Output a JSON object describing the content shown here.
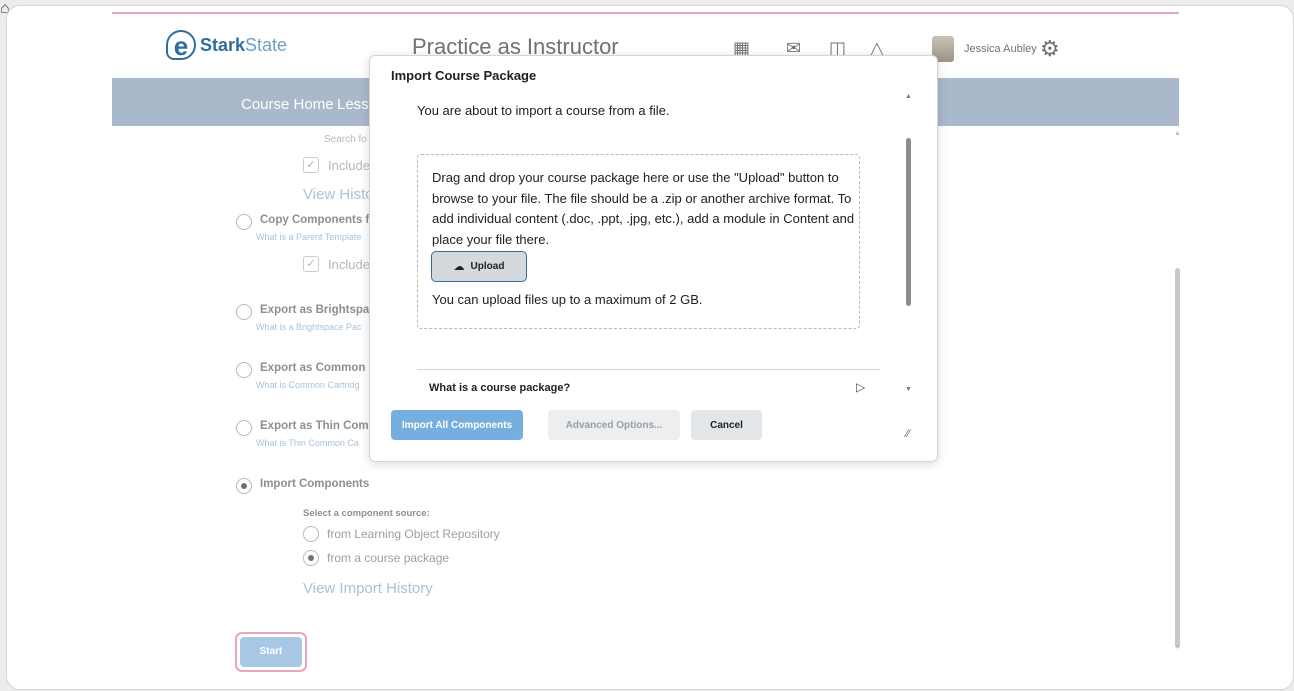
{
  "header": {
    "logo_bold": "Stark",
    "logo_light": "State",
    "org_unit_title": "Practice as Instructor",
    "user_name": "Jessica Aubley",
    "icons": [
      "home-icon",
      "grid-icon",
      "mail-icon",
      "chat-icon",
      "bell-icon",
      "gear-icon"
    ]
  },
  "navbar": {
    "items": [
      "Course Home",
      "Lesso"
    ]
  },
  "page": {
    "search_hint": "Search fo",
    "include_label_1": "Include p",
    "view_history": "View Histo",
    "include_label_2": "Include p",
    "options": [
      {
        "title": "Copy Components fr",
        "subtitle": "What is a Parent Template"
      },
      {
        "title": "Export as Brightspace",
        "subtitle": "What is a Brightspace Pac"
      },
      {
        "title": "Export as Common C",
        "subtitle": "What is Common Cartridg"
      },
      {
        "title": "Export as Thin Comm",
        "subtitle": "What is Thin Common Ca"
      },
      {
        "title": "Import Components",
        "subtitle": ""
      }
    ],
    "component_source_label": "Select a component source:",
    "sources": [
      "from Learning Object Repository",
      "from a course package"
    ],
    "view_import_history": "View Import History",
    "start_label": "Start"
  },
  "dialog": {
    "title": "Import Course Package",
    "intro": "You are about to import a course from a file.",
    "dropzone_text": "Drag and drop your course package here or use the \"Upload\" button to browse to your file. The file should be a .zip or another archive format. To add individual content (.doc, .ppt, .jpg, etc.), add a module in Content and place your file there.",
    "upload_label": "Upload",
    "limit_text": "You can upload files up to a maximum of 2 GB.",
    "accordion_label": "What is a course package?",
    "buttons": {
      "primary": "Import All Components",
      "advanced": "Advanced Options...",
      "cancel": "Cancel"
    }
  },
  "colors": {
    "navbar": "#a9b9cb",
    "accent_pink": "#e8a6b8",
    "primary_button": "#76aee0",
    "link": "#a8c3da"
  }
}
